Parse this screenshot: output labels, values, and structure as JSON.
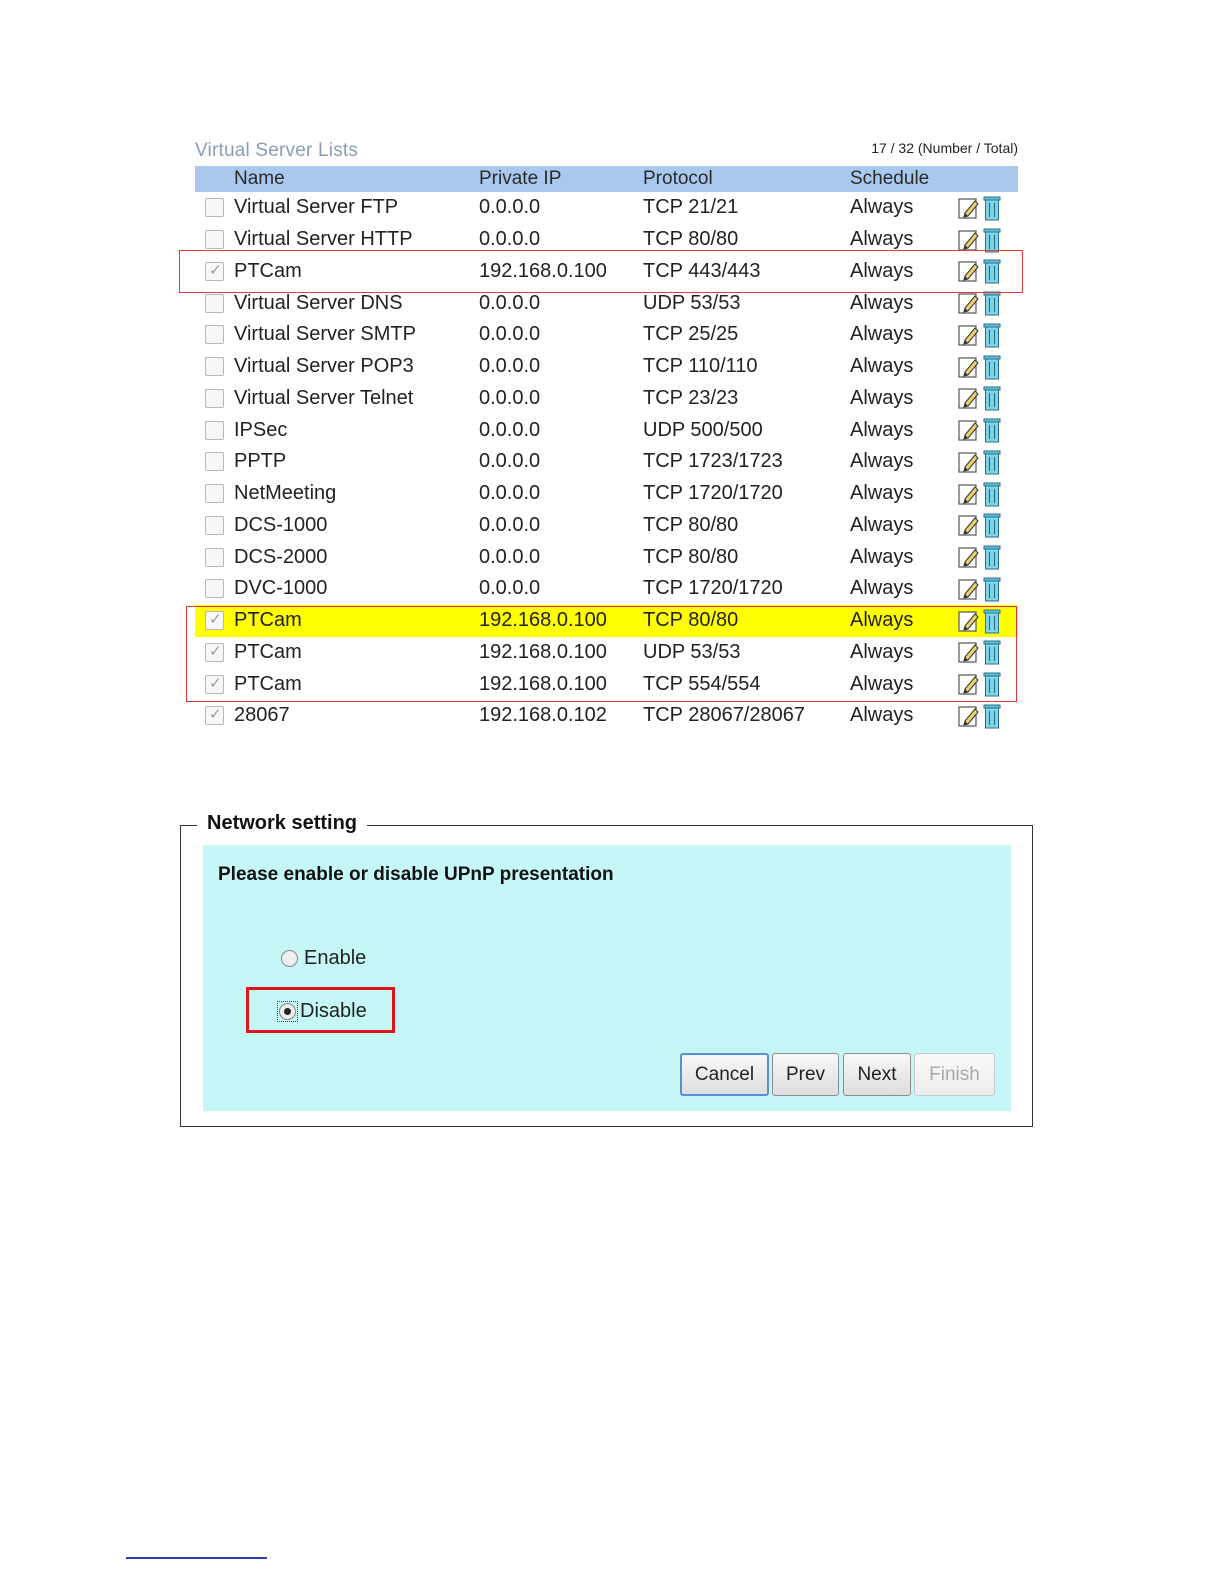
{
  "virtual_server": {
    "title": "Virtual Server Lists",
    "count": "17 / 32 (Number / Total)",
    "columns": {
      "name": "Name",
      "ip": "Private IP",
      "protocol": "Protocol",
      "schedule": "Schedule"
    },
    "rows": [
      {
        "checked": false,
        "name": "Virtual Server FTP",
        "ip": "0.0.0.0",
        "protocol": "TCP 21/21",
        "schedule": "Always"
      },
      {
        "checked": false,
        "name": "Virtual Server HTTP",
        "ip": "0.0.0.0",
        "protocol": "TCP 80/80",
        "schedule": "Always"
      },
      {
        "checked": true,
        "name": "PTCam",
        "ip": "192.168.0.100",
        "protocol": "TCP 443/443",
        "schedule": "Always"
      },
      {
        "checked": false,
        "name": "Virtual Server DNS",
        "ip": "0.0.0.0",
        "protocol": "UDP 53/53",
        "schedule": "Always"
      },
      {
        "checked": false,
        "name": "Virtual Server SMTP",
        "ip": "0.0.0.0",
        "protocol": "TCP 25/25",
        "schedule": "Always"
      },
      {
        "checked": false,
        "name": "Virtual Server POP3",
        "ip": "0.0.0.0",
        "protocol": "TCP 110/110",
        "schedule": "Always"
      },
      {
        "checked": false,
        "name": "Virtual Server Telnet",
        "ip": "0.0.0.0",
        "protocol": "TCP 23/23",
        "schedule": "Always"
      },
      {
        "checked": false,
        "name": "IPSec",
        "ip": "0.0.0.0",
        "protocol": "UDP 500/500",
        "schedule": "Always"
      },
      {
        "checked": false,
        "name": "PPTP",
        "ip": "0.0.0.0",
        "protocol": "TCP 1723/1723",
        "schedule": "Always"
      },
      {
        "checked": false,
        "name": "NetMeeting",
        "ip": "0.0.0.0",
        "protocol": "TCP 1720/1720",
        "schedule": "Always"
      },
      {
        "checked": false,
        "name": "DCS-1000",
        "ip": "0.0.0.0",
        "protocol": "TCP 80/80",
        "schedule": "Always"
      },
      {
        "checked": false,
        "name": "DCS-2000",
        "ip": "0.0.0.0",
        "protocol": "TCP 80/80",
        "schedule": "Always"
      },
      {
        "checked": false,
        "name": "DVC-1000",
        "ip": "0.0.0.0",
        "protocol": "TCP 1720/1720",
        "schedule": "Always"
      },
      {
        "checked": true,
        "name": "PTCam",
        "ip": "192.168.0.100",
        "protocol": "TCP 80/80",
        "schedule": "Always",
        "highlight": true
      },
      {
        "checked": true,
        "name": "PTCam",
        "ip": "192.168.0.100",
        "protocol": "UDP 53/53",
        "schedule": "Always"
      },
      {
        "checked": true,
        "name": "PTCam",
        "ip": "192.168.0.100",
        "protocol": "TCP 554/554",
        "schedule": "Always"
      },
      {
        "checked": true,
        "name": "28067",
        "ip": "192.168.0.102",
        "protocol": "TCP 28067/28067",
        "schedule": "Always"
      }
    ],
    "colors": {
      "header_bg": "#a9c8ee",
      "highlight": "#ffff00",
      "annotation": "#e23a3a"
    }
  },
  "network_setting": {
    "legend": "Network setting",
    "question": "Please enable or disable UPnP presentation",
    "options": [
      {
        "label": "Enable",
        "selected": false
      },
      {
        "label": "Disable",
        "selected": true
      }
    ],
    "buttons": {
      "cancel": "Cancel",
      "prev": "Prev",
      "next": "Next",
      "finish": "Finish"
    },
    "colors": {
      "panel_bg": "#c6f7f7",
      "annotation": "#e0141c"
    }
  }
}
